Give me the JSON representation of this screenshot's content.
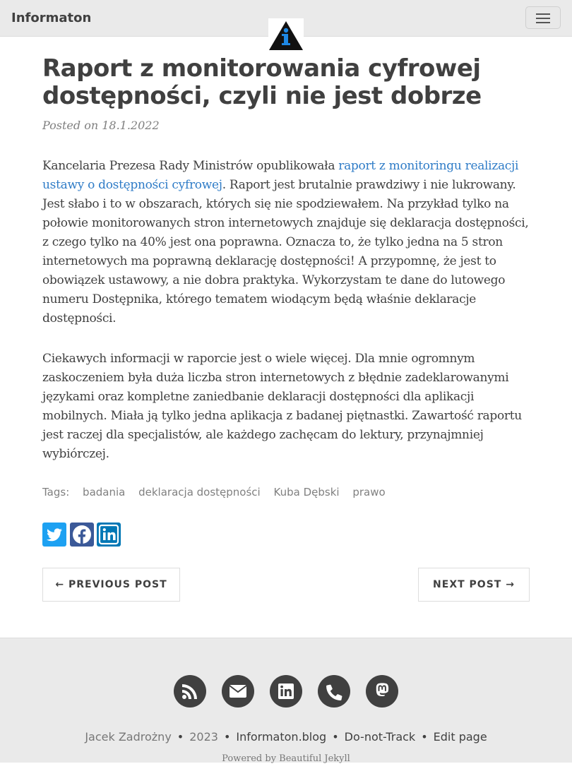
{
  "nav": {
    "brand": "Informaton"
  },
  "post": {
    "title": "Raport z monitorowania cyfrowej dostępności, czyli nie jest dobrze",
    "posted_on": "Posted on 18.1.2022",
    "p1_before": "Kancelaria Prezesa Rady Ministrów opublikowała ",
    "p1_link": "raport z monitoringu realizacji ustawy o dostępności cyfrowej",
    "p1_after": ". Raport jest brutalnie prawdziwy i nie lukrowany. Jest słabo i to w obszarach, których się nie spodziewałem. Na przykład tylko na połowie monitorowanych stron internetowych znajduje się deklaracja dostępności, z czego tylko na 40% jest ona poprawna. Oznacza to, że tylko jedna na 5 stron internetowych ma poprawną deklarację dostępności! A przypomnę, że jest to obowiązek ustawowy, a nie dobra praktyka. Wykorzystam te dane do lutowego numeru Dostępnika, którego tematem wiodącym będą właśnie deklaracje dostępności.",
    "p2": "Ciekawych informacji w raporcie jest o wiele więcej. Dla mnie ogromnym zaskoczeniem była duża liczba stron internetowych z błędnie zadeklarowanymi językami oraz kompletne zaniedbanie deklaracji dostępności dla aplikacji mobilnych. Miała ją tylko jedna aplikacja z badanej piętnastki. Zawartość raportu jest raczej dla specjalistów, ale każdego zachęcam do lektury, przynajmniej wybiórczej."
  },
  "tags": {
    "label": "Tags:",
    "items": [
      "badania",
      "deklaracja dostępności",
      "Kuba Dębski",
      "prawo"
    ]
  },
  "share": {
    "twitter_color": "#1da1f2",
    "facebook_color": "#3b5998",
    "linkedin_color": "#0077b5"
  },
  "pager": {
    "previous": "← PREVIOUS POST",
    "next": "NEXT POST →"
  },
  "footer": {
    "icons": [
      "rss-icon",
      "envelope-icon",
      "linkedin-icon",
      "phone-icon",
      "mastodon-icon"
    ],
    "author": "Jacek Zadrożny",
    "year": "2023",
    "site": "Informaton.blog",
    "dnt": "Do-not-Track",
    "edit": "Edit page",
    "powered": "Powered by Beautiful Jekyll"
  }
}
